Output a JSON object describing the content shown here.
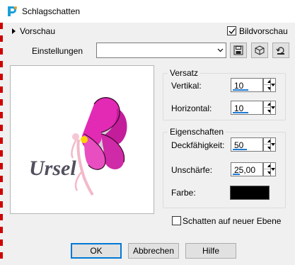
{
  "window": {
    "title": "Schlagschatten"
  },
  "preview_toggle": {
    "label": "Vorschau"
  },
  "bildvorschau": {
    "label": "Bildvorschau",
    "checked": true
  },
  "einstellungen": {
    "label": "Einstellungen",
    "value": ""
  },
  "preview": {
    "watermark_text": "Ursel"
  },
  "versatz": {
    "title": "Versatz",
    "vertikal": {
      "label": "Vertikal:",
      "value": "10",
      "fill": 0.55
    },
    "horizontal": {
      "label": "Horizontal:",
      "value": "10",
      "fill": 0.55
    }
  },
  "eigenschaften": {
    "title": "Eigenschaften",
    "deckfaehigkeit": {
      "label": "Deckfähigkeit:",
      "value": "50",
      "fill": 0.5
    },
    "unschaerfe": {
      "label": "Unschärfe:",
      "value": "25,00",
      "fill": 0.25
    },
    "farbe": {
      "label": "Farbe:",
      "color": "#000000"
    }
  },
  "schatten_ebene": {
    "label": "Schatten auf neuer Ebene",
    "checked": false
  },
  "buttons": {
    "ok": "OK",
    "abbrechen": "Abbrechen",
    "hilfe": "Hilfe"
  },
  "colors": {
    "accent": "#1e7bd6",
    "focus": "#0078d7",
    "edge_marker": "#d00000"
  }
}
